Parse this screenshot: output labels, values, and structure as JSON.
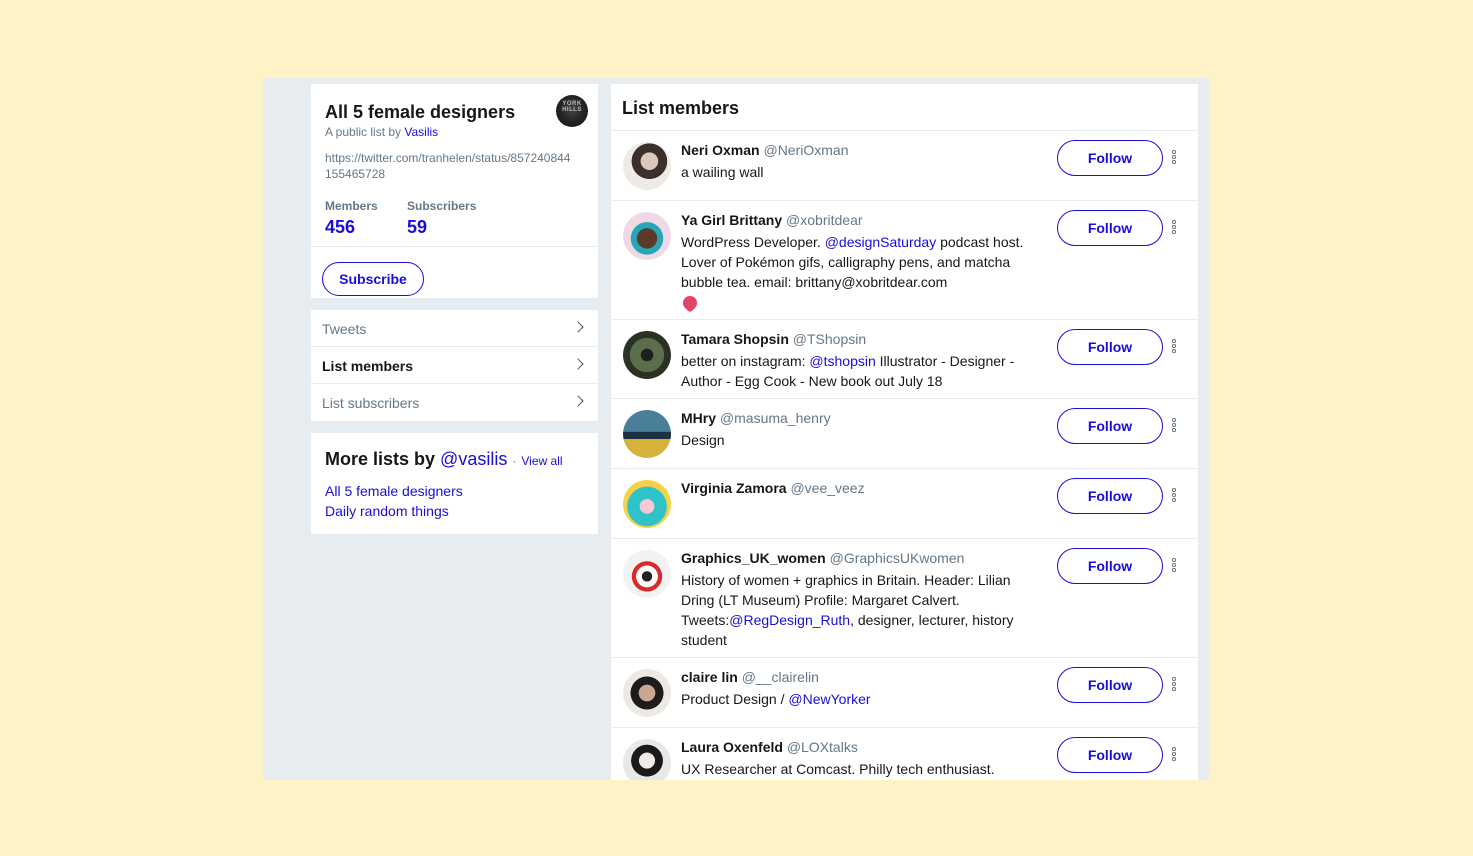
{
  "list": {
    "title": "All 5 female designers",
    "byline_prefix": "A public list by",
    "owner": "Vasilis",
    "description": "https://twitter.com/tranhelen/status/857240844155465728",
    "members_label": "Members",
    "members_count": "456",
    "subscribers_label": "Subscribers",
    "subscribers_count": "59",
    "subscribe_label": "Subscribe",
    "owner_avatar_text": "YORK HILLS"
  },
  "nav": [
    {
      "label": "Tweets"
    },
    {
      "label": "List members"
    },
    {
      "label": "List subscribers"
    }
  ],
  "more_lists": {
    "heading": "More lists by",
    "handle": "@vasilis",
    "separator": "·",
    "view_all": "View all",
    "links": [
      "All 5 female designers",
      "Daily random things"
    ]
  },
  "members_panel": {
    "title": "List members",
    "follow_label": "Follow",
    "members": [
      {
        "name": "Neri Oxman",
        "handle": "@NeriOxman",
        "bio": [
          {
            "t": "a wailing wall"
          }
        ]
      },
      {
        "name": "Ya Girl Brittany",
        "handle": "@xobritdear",
        "bio": [
          {
            "t": "WordPress Developer. "
          },
          {
            "t": "@designSaturday",
            "m": true
          },
          {
            "t": " podcast host. Lover of Pokémon gifs, calligraphy pens, and matcha bubble tea. email: brittany@xobritdear.com"
          }
        ],
        "heart": true
      },
      {
        "name": "Tamara Shopsin",
        "handle": "@TShopsin",
        "bio": [
          {
            "t": "better on instagram: "
          },
          {
            "t": "@tshopsin",
            "m": true
          },
          {
            "t": " Illustrator - Designer - Author - Egg Cook - New book out July 18"
          }
        ]
      },
      {
        "name": "MHry",
        "handle": "@masuma_henry",
        "bio": [
          {
            "t": "Design"
          }
        ]
      },
      {
        "name": "Virginia Zamora",
        "handle": "@vee_veez",
        "bio": []
      },
      {
        "name": "Graphics_UK_women",
        "handle": "@GraphicsUKwomen",
        "bio": [
          {
            "t": "History of women + graphics in Britain. Header: Lilian Dring (LT Museum) Profile: Margaret Calvert. Tweets:"
          },
          {
            "t": "@RegDesign_Ruth",
            "m": true
          },
          {
            "t": ", designer, lecturer, history student"
          }
        ]
      },
      {
        "name": "claire lin",
        "handle": "@__clairelin",
        "bio": [
          {
            "t": "Product Design / "
          },
          {
            "t": "@NewYorker",
            "m": true
          }
        ]
      },
      {
        "name": "Laura Oxenfeld",
        "handle": "@LOXtalks",
        "bio": [
          {
            "t": "UX Researcher at Comcast. Philly tech enthusiast."
          }
        ]
      }
    ]
  },
  "colors": {
    "accent": "#1a0dd9",
    "background": "#fdf3c6",
    "frame": "#e6ecf0",
    "muted_text": "#657786"
  }
}
